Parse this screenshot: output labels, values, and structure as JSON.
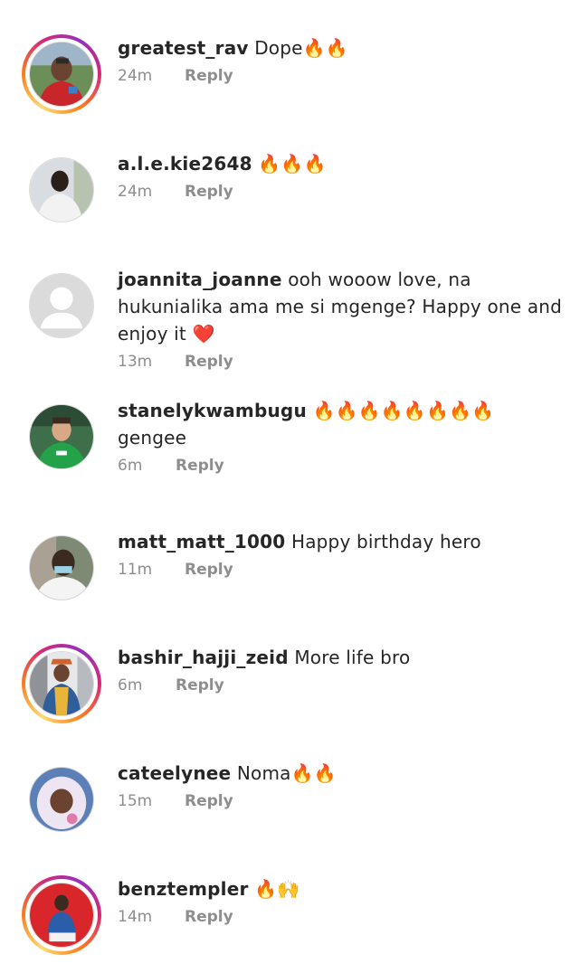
{
  "comments": [
    {
      "username": "greatest_rav",
      "text": "Dope🔥🔥",
      "time": "24m",
      "reply": "Reply",
      "story": true
    },
    {
      "username": "a.l.e.kie2648",
      "text": "🔥🔥🔥",
      "time": "24m",
      "reply": "Reply",
      "story": false
    },
    {
      "username": "joannita_joanne",
      "text": "ooh wooow love, na hukunialika ama me si mgenge? Happy one and enjoy it ❤️",
      "time": "13m",
      "reply": "Reply",
      "story": false
    },
    {
      "username": "stanelykwambugu",
      "text": "🔥🔥🔥🔥🔥🔥🔥🔥 gengee",
      "time": "6m",
      "reply": "Reply",
      "story": false
    },
    {
      "username": "matt_matt_1000",
      "text": "Happy birthday  hero",
      "time": "11m",
      "reply": "Reply",
      "story": false
    },
    {
      "username": "bashir_hajji_zeid",
      "text": "More life bro",
      "time": "6m",
      "reply": "Reply",
      "story": true
    },
    {
      "username": "cateelynee",
      "text": "Noma🔥🔥",
      "time": "15m",
      "reply": "Reply",
      "story": false
    },
    {
      "username": "benztempler",
      "text": "🔥🙌",
      "time": "14m",
      "reply": "Reply",
      "story": true
    }
  ],
  "colors": {
    "text": "#262626",
    "secondary": "#8e8e8e",
    "story_ring": [
      "#feda75",
      "#fa7e1e",
      "#d62976",
      "#962fbf"
    ]
  }
}
